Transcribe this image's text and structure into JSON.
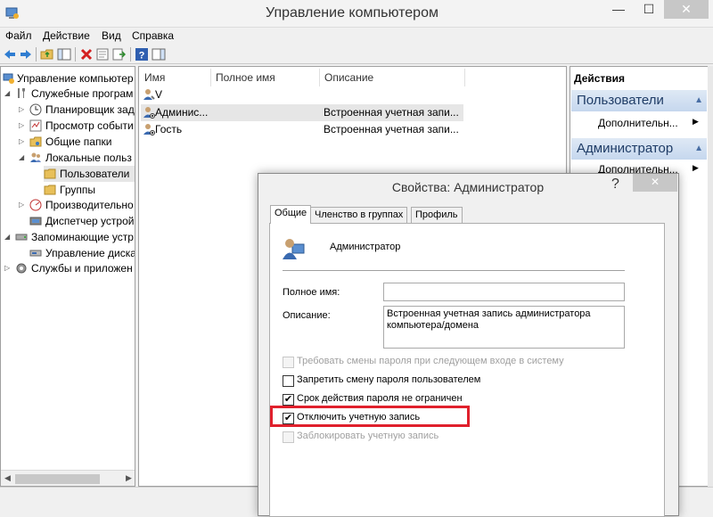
{
  "window": {
    "title": "Управление компьютером",
    "minimize": "—",
    "maximize": "☐",
    "close": "✕"
  },
  "menu": [
    "Файл",
    "Действие",
    "Вид",
    "Справка"
  ],
  "tree": [
    {
      "label": "Управление компьютер",
      "expander": "",
      "icon": "computer-management-icon"
    },
    {
      "label": "Служебные програм",
      "expander": "◢",
      "icon": "tools-icon"
    },
    {
      "label": "Планировщик зад",
      "expander": "▷",
      "icon": "clock-icon"
    },
    {
      "label": "Просмотр событи",
      "expander": "▷",
      "icon": "event-viewer-icon"
    },
    {
      "label": "Общие папки",
      "expander": "▷",
      "icon": "shared-folder-icon"
    },
    {
      "label": "Локальные польз",
      "expander": "◢",
      "icon": "users-icon"
    },
    {
      "label": "Пользователи",
      "expander": "",
      "icon": "folder-icon"
    },
    {
      "label": "Группы",
      "expander": "",
      "icon": "folder-icon"
    },
    {
      "label": "Производительно",
      "expander": "▷",
      "icon": "performance-icon"
    },
    {
      "label": "Диспетчер устрой",
      "expander": "",
      "icon": "device-manager-icon"
    },
    {
      "label": "Запоминающие устр",
      "expander": "◢",
      "icon": "storage-icon"
    },
    {
      "label": "Управление диска",
      "expander": "",
      "icon": "disk-icon"
    },
    {
      "label": "Службы и приложен",
      "expander": "▷",
      "icon": "services-icon"
    }
  ],
  "list": {
    "columns": [
      "Имя",
      "Полное имя",
      "Описание"
    ],
    "rows": [
      {
        "name": "V",
        "fullname": "",
        "description": ""
      },
      {
        "name": "Админис...",
        "fullname": "",
        "description": "Встроенная учетная запи..."
      },
      {
        "name": "Гость",
        "fullname": "",
        "description": "Встроенная учетная запи..."
      }
    ]
  },
  "actions": {
    "title": "Действия",
    "sections": [
      {
        "label": "Пользователи",
        "item": "Дополнительн..."
      },
      {
        "label": "Администратор",
        "item": "Дополнительн..."
      }
    ]
  },
  "dialog": {
    "title": "Свойства: Администратор",
    "help": "?",
    "close": "✕",
    "tabs": [
      "Общие",
      "Членство в группах",
      "Профиль"
    ],
    "user_name": "Администратор",
    "fullname_label": "Полное имя:",
    "fullname_value": "",
    "description_label": "Описание:",
    "description_value": "Встроенная учетная запись администратора компьютера/домена",
    "checkboxes": [
      {
        "label": "Требовать смены пароля при следующем входе в систему",
        "checked": false,
        "enabled": false
      },
      {
        "label": "Запретить смену пароля пользователем",
        "checked": false,
        "enabled": true
      },
      {
        "label": "Срок действия пароля не ограничен",
        "checked": true,
        "enabled": true
      },
      {
        "label": "Отключить учетную запись",
        "checked": true,
        "enabled": true
      },
      {
        "label": "Заблокировать учетную запись",
        "checked": false,
        "enabled": false
      }
    ],
    "highlight_color": "#e0202c"
  }
}
